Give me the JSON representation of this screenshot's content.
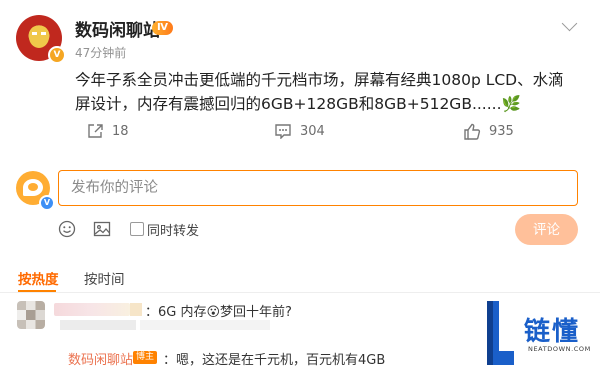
{
  "post": {
    "username": "数码闲聊站",
    "level_badge": "Ⅳ",
    "verified_badge": "V",
    "time": "47分钟前",
    "content": "今年子系全员冲击更低端的千元档市场，屏幕有经典1080p LCD、水滴屏设计，内存有震撼回归的6GB+128GB和8GB+512GB......",
    "emoji": "🌿"
  },
  "actions": {
    "repost_count": "18",
    "comment_count": "304",
    "like_count": "935"
  },
  "comment_box": {
    "placeholder": "发布你的评论",
    "verified_badge": "V",
    "repost_label": "同时转发",
    "submit_label": "评论"
  },
  "sort_tabs": {
    "hot": "按热度",
    "time": "按时间"
  },
  "comments": [
    {
      "text": "：6G 内存😮梦回十年前?",
      "reply": {
        "name": "数码闲聊站",
        "badge": "博主",
        "text": "：嗯，这还是在千元机，百元机有4GB"
      }
    }
  ],
  "watermark": {
    "brand": "链懂",
    "site": "NEATDOWN.COM"
  },
  "colors": {
    "accent": "#ff8200",
    "hot_tab": "#ff6a00",
    "submit_disabled": "#ffc09a",
    "reply_name": "#eb7350",
    "watermark_blue": "#1a5fc9"
  }
}
